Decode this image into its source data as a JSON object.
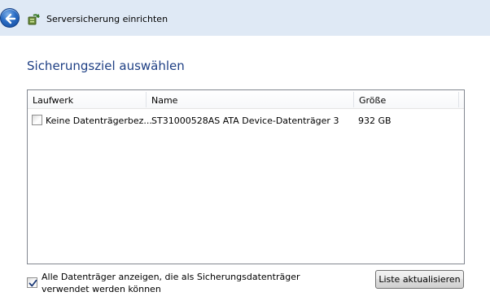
{
  "window": {
    "title": "Serversicherung einrichten"
  },
  "page": {
    "heading": "Sicherungsziel auswählen"
  },
  "disk_list": {
    "columns": [
      "Laufwerk",
      "Name",
      "Größe"
    ],
    "rows": [
      {
        "checked": false,
        "drive": "Keine Datenträgerbez...",
        "name": "ST31000528AS ATA Device-Datenträger 3",
        "size": "932 GB"
      }
    ]
  },
  "options": {
    "show_all_checked": true,
    "show_all_line1": "Alle Datenträger anzeigen, die als Sicherungsdatenträger",
    "show_all_line2": "verwendet werden können"
  },
  "buttons": {
    "refresh_label": "Liste aktualisieren"
  },
  "icons": {
    "back": "back-arrow-icon",
    "app": "server-backup-icon",
    "check": "checkmark-icon"
  },
  "colors": {
    "titlebar_bg": "#dfe9f5",
    "heading": "#1e3f84",
    "back_button": "#2a6cc4"
  }
}
